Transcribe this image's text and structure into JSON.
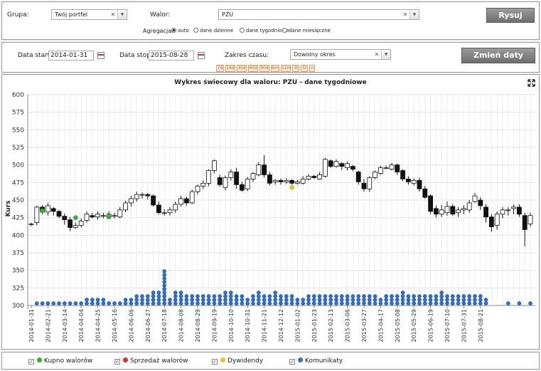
{
  "controls": {
    "group_label": "Grupa:",
    "group_value": "Twój portfel",
    "asset_label": "Walor:",
    "asset_value": "PZU",
    "draw_button": "Rysuj",
    "aggregation_label": "Agregacja:",
    "aggregation_options": [
      "auto",
      "dane dzienne",
      "dane tygodniowe",
      "dane miesięczne"
    ],
    "aggregation_selected": "auto",
    "date_start_label": "Data start:",
    "date_start": "2014-01-31",
    "date_stop_label": "Data stop:",
    "date_stop": "2015-08-28",
    "range_label": "Zakres czasu:",
    "range_value": "Dowolny okres",
    "change_dates_button": "Zmień daty",
    "quick_ranges": [
      "7d",
      "14d",
      "30d",
      "60d",
      "90d",
      "6m",
      "12m",
      "3l",
      "5l",
      "∞"
    ]
  },
  "legend": {
    "items": [
      {
        "label": "Kupno walorów",
        "color": "#2db52d"
      },
      {
        "label": "Sprzedaż walorów",
        "color": "#e03030"
      },
      {
        "label": "Dywidendy",
        "color": "#e8c81a"
      },
      {
        "label": "Komunikaty",
        "color": "#2f6fd0"
      }
    ]
  },
  "chart_data": {
    "type": "candlestick",
    "title": "Wykres świecowy dla waloru: PZU - dane tygodniowe",
    "ylabel": "Kurs",
    "ylim": [
      300,
      600
    ],
    "yticks": [
      300,
      325,
      350,
      375,
      400,
      425,
      450,
      475,
      500,
      525,
      550,
      575,
      600
    ],
    "xticks": [
      "2014-01-31",
      "2014-02-21",
      "2014-03-14",
      "2014-04-04",
      "2014-04-25",
      "2014-05-16",
      "2014-06-06",
      "2014-06-27",
      "2014-07-18",
      "2014-08-08",
      "2014-08-29",
      "2014-09-19",
      "2014-10-10",
      "2014-10-31",
      "2014-11-21",
      "2014-12-12",
      "2015-01-02",
      "2015-01-23",
      "2015-02-13",
      "2015-03-06",
      "2015-03-27",
      "2015-04-17",
      "2015-05-08",
      "2015-05-29",
      "2015-06-19",
      "2015-07-10",
      "2015-07-31",
      "2015-08-21"
    ],
    "grid": true,
    "ohlc": [
      [
        416,
        416,
        418,
        413
      ],
      [
        418,
        440,
        442,
        414
      ],
      [
        440,
        433,
        443,
        430
      ],
      [
        433,
        442,
        446,
        428
      ],
      [
        438,
        434,
        440,
        428
      ],
      [
        434,
        427,
        436,
        424
      ],
      [
        427,
        422,
        431,
        415
      ],
      [
        422,
        411,
        426,
        406
      ],
      [
        411,
        414,
        418,
        409
      ],
      [
        414,
        420,
        424,
        411
      ],
      [
        421,
        430,
        434,
        418
      ],
      [
        428,
        426,
        432,
        424
      ],
      [
        426,
        430,
        434,
        422
      ],
      [
        428,
        428,
        432,
        424
      ],
      [
        426,
        430,
        434,
        423
      ],
      [
        428,
        428,
        432,
        424
      ],
      [
        426,
        436,
        440,
        424
      ],
      [
        436,
        446,
        449,
        433
      ],
      [
        446,
        452,
        456,
        441
      ],
      [
        452,
        458,
        462,
        448
      ],
      [
        458,
        458,
        461,
        452
      ],
      [
        458,
        456,
        460,
        451
      ],
      [
        456,
        443,
        458,
        441
      ],
      [
        443,
        432,
        448,
        430
      ],
      [
        432,
        432,
        437,
        428
      ],
      [
        432,
        436,
        440,
        428
      ],
      [
        436,
        444,
        448,
        432
      ],
      [
        444,
        452,
        456,
        441
      ],
      [
        452,
        446,
        455,
        442
      ],
      [
        446,
        462,
        465,
        444
      ],
      [
        462,
        470,
        472,
        458
      ],
      [
        470,
        474,
        478,
        466
      ],
      [
        474,
        492,
        494,
        470
      ],
      [
        492,
        506,
        508,
        488
      ],
      [
        482,
        472,
        486,
        469
      ],
      [
        468,
        482,
        485,
        464
      ],
      [
        482,
        490,
        494,
        478
      ],
      [
        490,
        472,
        496,
        466
      ],
      [
        472,
        464,
        476,
        462
      ],
      [
        466,
        480,
        483,
        463
      ],
      [
        480,
        488,
        490,
        476
      ],
      [
        486,
        500,
        504,
        484
      ],
      [
        500,
        486,
        514,
        482
      ],
      [
        486,
        474,
        490,
        471
      ],
      [
        476,
        478,
        480,
        472
      ],
      [
        478,
        476,
        481,
        472
      ],
      [
        476,
        478,
        481,
        473
      ],
      [
        478,
        474,
        480,
        472
      ],
      [
        474,
        476,
        479,
        472
      ],
      [
        474,
        480,
        484,
        472
      ],
      [
        480,
        484,
        487,
        478
      ],
      [
        484,
        482,
        486,
        480
      ],
      [
        480,
        486,
        490,
        479
      ],
      [
        484,
        508,
        510,
        482
      ],
      [
        506,
        498,
        508,
        496
      ],
      [
        498,
        505,
        508,
        496
      ],
      [
        502,
        498,
        504,
        493
      ],
      [
        496,
        502,
        505,
        492
      ],
      [
        498,
        494,
        500,
        491
      ],
      [
        490,
        476,
        492,
        472
      ],
      [
        474,
        466,
        480,
        462
      ],
      [
        466,
        482,
        484,
        462
      ],
      [
        482,
        490,
        492,
        480
      ],
      [
        488,
        496,
        499,
        486
      ],
      [
        496,
        496,
        499,
        494
      ],
      [
        494,
        500,
        503,
        492
      ],
      [
        500,
        490,
        502,
        486
      ],
      [
        492,
        480,
        494,
        477
      ],
      [
        480,
        476,
        484,
        472
      ],
      [
        474,
        478,
        481,
        471
      ],
      [
        478,
        466,
        482,
        462
      ],
      [
        466,
        454,
        470,
        452
      ],
      [
        456,
        434,
        458,
        430
      ],
      [
        438,
        430,
        442,
        425
      ],
      [
        430,
        436,
        443,
        426
      ],
      [
        432,
        441,
        448,
        428
      ],
      [
        441,
        430,
        444,
        428
      ],
      [
        432,
        436,
        440,
        426
      ],
      [
        436,
        438,
        443,
        430
      ],
      [
        436,
        446,
        450,
        432
      ],
      [
        448,
        456,
        460,
        446
      ],
      [
        450,
        442,
        454,
        436
      ],
      [
        440,
        426,
        444,
        418
      ],
      [
        426,
        412,
        430,
        405
      ],
      [
        414,
        430,
        434,
        408
      ],
      [
        430,
        436,
        440,
        424
      ],
      [
        436,
        436,
        440,
        428
      ],
      [
        438,
        440,
        444,
        430
      ],
      [
        440,
        430,
        444,
        426
      ],
      [
        428,
        408,
        432,
        384
      ],
      [
        416,
        428,
        432,
        412
      ]
    ],
    "events": {
      "buy": [
        [
          2,
          435
        ],
        [
          8,
          425
        ],
        [
          14,
          426
        ]
      ],
      "dividend": [
        [
          47,
          468
        ]
      ],
      "comm_indices": [
        1,
        2,
        3,
        4,
        5,
        6,
        7,
        8,
        9,
        10,
        11,
        12,
        13,
        14,
        15,
        16,
        17,
        18,
        19,
        20,
        21,
        22,
        23,
        24,
        25,
        26,
        27,
        28,
        29,
        30,
        31,
        32,
        33,
        34,
        35,
        36,
        37,
        38,
        39,
        40,
        41,
        42,
        43,
        44,
        45,
        46,
        47,
        48,
        49,
        50,
        51,
        52,
        53,
        54,
        55,
        56,
        57,
        58,
        59,
        60,
        61,
        62,
        63,
        64,
        65,
        66,
        67,
        68,
        69,
        70,
        71,
        72,
        73,
        74,
        75,
        76,
        77,
        78,
        79,
        80,
        81,
        82,
        83,
        84,
        85,
        86,
        87,
        88,
        89,
        90
      ],
      "comm_counts": [
        1,
        1,
        1,
        1,
        1,
        1,
        1,
        1,
        1,
        2,
        2,
        2,
        2,
        1,
        1,
        1,
        2,
        2,
        3,
        3,
        3,
        4,
        4,
        10,
        2,
        4,
        4,
        3,
        3,
        3,
        3,
        3,
        3,
        3,
        4,
        4,
        3,
        3,
        2,
        3,
        4,
        3,
        3,
        4,
        3,
        3,
        3,
        2,
        2,
        3,
        3,
        3,
        3,
        3,
        3,
        3,
        3,
        3,
        3,
        3,
        3,
        3,
        2,
        3,
        3,
        3,
        4,
        3,
        3,
        3,
        3,
        3,
        3,
        4,
        3,
        3,
        3,
        3,
        3,
        3,
        3,
        2,
        0,
        0,
        0,
        1,
        0,
        1,
        0,
        1,
        0
      ]
    }
  }
}
